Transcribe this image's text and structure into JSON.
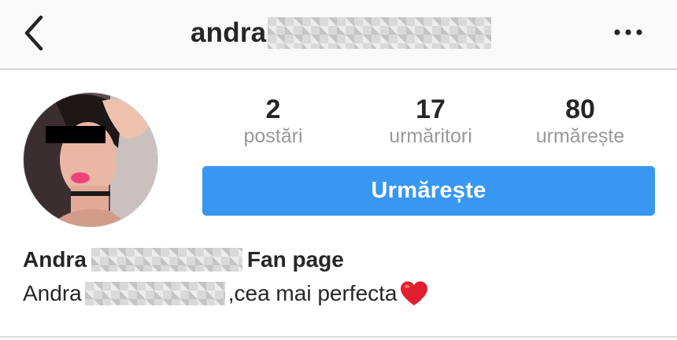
{
  "header": {
    "title": "andra",
    "back_icon": "chevron-left-icon",
    "more_icon": "more-horizontal-icon"
  },
  "profile": {
    "stats": [
      {
        "value": "2",
        "label": "postări"
      },
      {
        "value": "17",
        "label": "urmăritori"
      },
      {
        "value": "80",
        "label": "urmărește"
      }
    ],
    "follow_button_label": "Urmărește",
    "follow_button_color": "#3897f0"
  },
  "bio": {
    "name_first": "Andra",
    "name_suffix": "Fan page",
    "text_first": "Andra",
    "text_suffix": ",cea mai perfecta",
    "emoji_icon": "red-heart-icon"
  },
  "colors": {
    "text": "#262626",
    "muted": "#999999",
    "accent": "#3897f0",
    "heart": "#e0202e"
  }
}
